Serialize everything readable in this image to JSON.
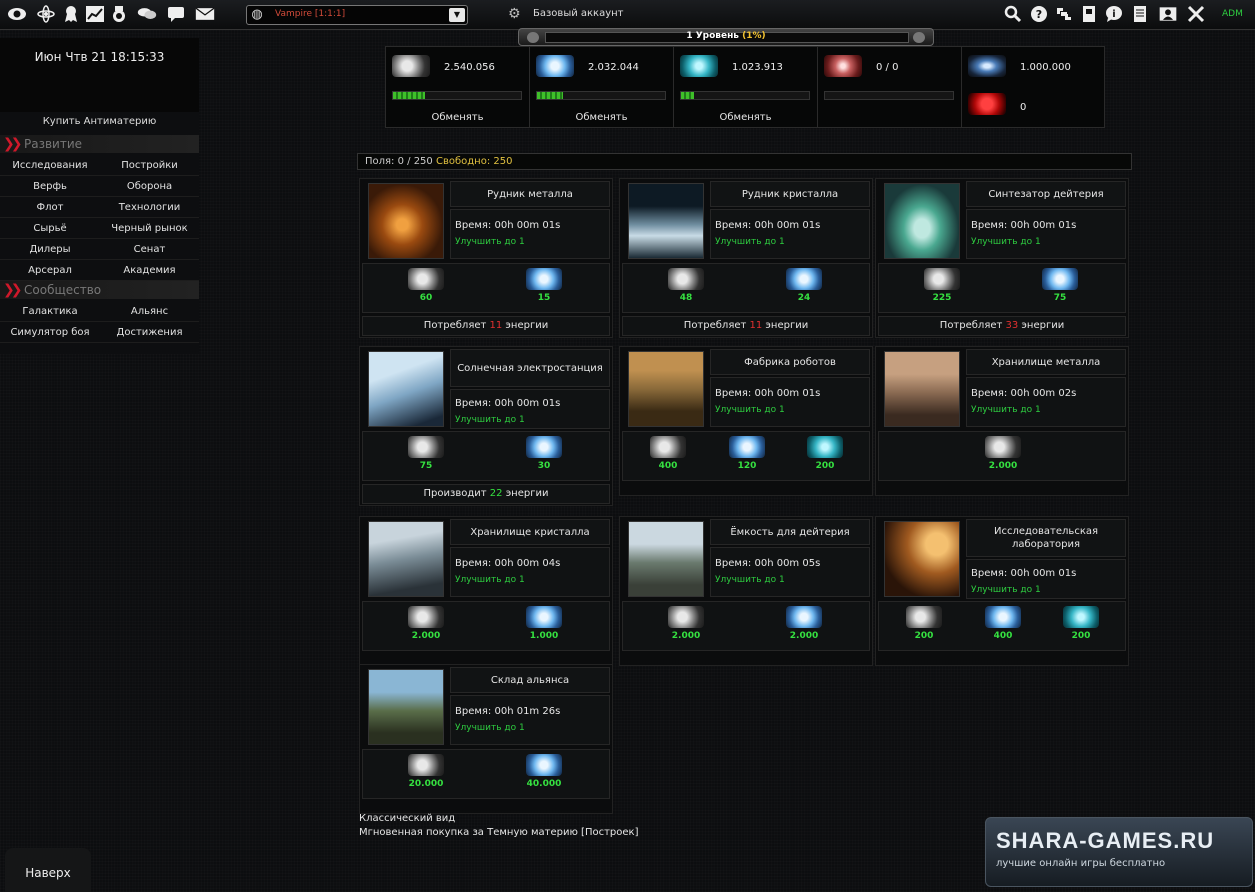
{
  "topbar": {
    "icons": [
      "eye-icon",
      "atom-icon",
      "ribbon-icon",
      "chart-icon",
      "medal-icon",
      "chat-icon",
      "message-icon",
      "mail-icon"
    ],
    "planet": "Vampire [1:1:1]",
    "account": "Базовый аккаунт",
    "right_icons": [
      "search-icon",
      "help-icon",
      "fullscreen-icon",
      "notes-icon",
      "info-icon",
      "document-icon",
      "user-icon",
      "tools-icon"
    ],
    "adm": "ADM"
  },
  "level": {
    "text": "1 Уровень",
    "percent": "(1%)"
  },
  "resources": [
    {
      "icon": "metal-icon",
      "value": "2.540.056",
      "fill": 0.25,
      "exchange": "Обменять"
    },
    {
      "icon": "crystal-icon",
      "value": "2.032.044",
      "fill": 0.2,
      "exchange": "Обменять"
    },
    {
      "icon": "deuterium-icon",
      "value": "1.023.913",
      "fill": 0.1,
      "exchange": "Обменять"
    },
    {
      "icon": "energy-icon",
      "value": "0 / 0",
      "fill": 0.0
    },
    {
      "icon": "dark-matter-icon",
      "value": "1.000.000"
    },
    {
      "icon": "antimatter-icon",
      "value": "0"
    }
  ],
  "sidebar": {
    "clock": "Июн Чтв 21 18:15:33",
    "buy_antimatter": "Купить Антиматерию",
    "section1": "Развитие",
    "nav1": [
      "Исследования",
      "Постройки",
      "Верфь",
      "Оборона",
      "Флот",
      "Технологии",
      "Сырьё",
      "Черный рынок",
      "Дилеры",
      "Сенат",
      "Арсерал",
      "Академия"
    ],
    "section2": "Сообщество",
    "nav2": [
      "Галактика",
      "Альянс",
      "Симулятор боя",
      "Достижения"
    ]
  },
  "fields": {
    "label": "Поля:",
    "value": "0 / 250",
    "free_label": "Свободно:",
    "free": "250"
  },
  "buildings": [
    {
      "name": "Рудник металла",
      "time": "Время: 00h 00m 01s",
      "upgrade": "Улучшить до 1",
      "costs": [
        [
          "metal",
          "60"
        ],
        [
          "crystal",
          "15"
        ]
      ],
      "energy_pre": "Потребляет",
      "energy_val": "11",
      "energy_post": "энергии",
      "energy_type": "neg"
    },
    {
      "name": "Рудник кристалла",
      "time": "Время: 00h 00m 01s",
      "upgrade": "Улучшить до 1",
      "costs": [
        [
          "metal",
          "48"
        ],
        [
          "crystal",
          "24"
        ]
      ],
      "energy_pre": "Потребляет",
      "energy_val": "11",
      "energy_post": "энергии",
      "energy_type": "neg"
    },
    {
      "name": "Синтезатор дейтерия",
      "time": "Время: 00h 00m 01s",
      "upgrade": "Улучшить до 1",
      "costs": [
        [
          "metal",
          "225"
        ],
        [
          "crystal",
          "75"
        ]
      ],
      "energy_pre": "Потребляет",
      "energy_val": "33",
      "energy_post": "энергии",
      "energy_type": "neg"
    },
    {
      "name": "Солнечная электростанция",
      "time": "Время: 00h 00m 01s",
      "upgrade": "Улучшить до 1",
      "costs": [
        [
          "metal",
          "75"
        ],
        [
          "crystal",
          "30"
        ]
      ],
      "energy_pre": "Производит",
      "energy_val": "22",
      "energy_post": "энергии",
      "energy_type": "pos"
    },
    {
      "name": "Фабрика роботов",
      "time": "Время: 00h 00m 01s",
      "upgrade": "Улучшить до 1",
      "costs": [
        [
          "metal",
          "400"
        ],
        [
          "crystal",
          "120"
        ],
        [
          "deut",
          "200"
        ]
      ]
    },
    {
      "name": "Хранилище металла",
      "time": "Время: 00h 00m 02s",
      "upgrade": "Улучшить до 1",
      "costs": [
        [
          "metal",
          "2.000"
        ]
      ]
    },
    {
      "name": "Хранилище кристалла",
      "time": "Время: 00h 00m 04s",
      "upgrade": "Улучшить до 1",
      "costs": [
        [
          "metal",
          "2.000"
        ],
        [
          "crystal",
          "1.000"
        ]
      ]
    },
    {
      "name": "Ёмкость для дейтерия",
      "time": "Время: 00h 00m 05s",
      "upgrade": "Улучшить до 1",
      "costs": [
        [
          "metal",
          "2.000"
        ],
        [
          "crystal",
          "2.000"
        ]
      ]
    },
    {
      "name": "Исследовательская лаборатория",
      "time": "Время: 00h 00m 01s",
      "upgrade": "Улучшить до 1",
      "costs": [
        [
          "metal",
          "200"
        ],
        [
          "crystal",
          "400"
        ],
        [
          "deut",
          "200"
        ]
      ]
    },
    {
      "name": "Склад альянса",
      "time": "Время: 00h 01m 26s",
      "upgrade": "Улучшить до 1",
      "costs": [
        [
          "metal",
          "20.000"
        ],
        [
          "crystal",
          "40.000"
        ]
      ]
    }
  ],
  "footer": {
    "classic": "Классический вид",
    "instant": "Мгновенная покупка за Темную материю [Построек]",
    "to_top": "Наверх",
    "logo_big": "SHARA-GAMES.RU",
    "logo_small": "лучшие онлайн игры бесплатно"
  }
}
